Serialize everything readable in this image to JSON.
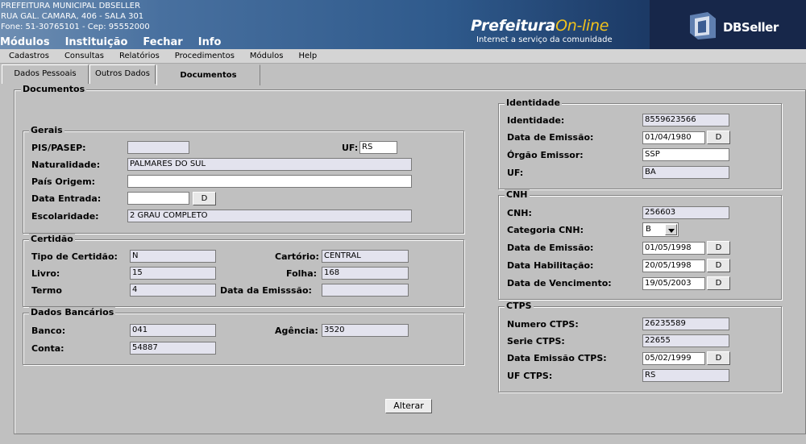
{
  "header": {
    "org_name": "PREFEITURA MUNICIPAL DBSELLER",
    "address": "RUA GAL. CAMARA, 406 - SALA 301",
    "phone_line": "Fone: 51-30765101  -  Cep: 95552000",
    "top_menu": [
      "Módulos",
      "Instituição",
      "Fechar",
      "Info"
    ],
    "logo_text": "Prefeitura",
    "logo_accent": "On-line",
    "logo_tagline": "Internet a serviço da comunidade",
    "brand": "DBSeller"
  },
  "menubar": [
    "Cadastros",
    "Consultas",
    "Relatórios",
    "Procedimentos",
    "Módulos",
    "Help"
  ],
  "tabs": [
    "Dados Pessoais",
    "Outros Dados",
    "Documentos"
  ],
  "active_tab": "Documentos",
  "panel_title": "Documentos",
  "gerais": {
    "title": "Gerais",
    "pis_label": "PIS/PASEP:",
    "pis_value": "",
    "uf_label": "UF:",
    "uf_value": "RS",
    "naturalidade_label": "Naturalidade:",
    "naturalidade_value": "PALMARES DO SUL",
    "pais_label": "País Origem:",
    "pais_value": "",
    "data_entrada_label": "Data Entrada:",
    "data_entrada_value": "",
    "escolaridade_label": "Escolaridade:",
    "escolaridade_value": "2 GRAU COMPLETO"
  },
  "certidao": {
    "title": "Certidão",
    "tipo_label": "Tipo de Certidão:",
    "tipo_value": "N",
    "cartorio_label": "Cartório:",
    "cartorio_value": "CENTRAL",
    "livro_label": "Livro:",
    "livro_value": "15",
    "folha_label": "Folha:",
    "folha_value": "168",
    "termo_label": "Termo",
    "termo_value": "4",
    "data_emissao_label": "Data da Emisssão:",
    "data_emissao_value": ""
  },
  "bancarios": {
    "title": "Dados Bancários",
    "banco_label": "Banco:",
    "banco_value": "041",
    "agencia_label": "Agência:",
    "agencia_value": "3520",
    "conta_label": "Conta:",
    "conta_value": "54887"
  },
  "identidade": {
    "title": "Identidade",
    "identidade_label": "Identidade:",
    "identidade_value": "8559623566",
    "data_emissao_label": "Data de Emissão:",
    "data_emissao_value": "01/04/1980",
    "orgao_label": "Órgão Emissor:",
    "orgao_value": "SSP",
    "uf_label": "UF:",
    "uf_value": "BA"
  },
  "cnh": {
    "title": "CNH",
    "cnh_label": "CNH:",
    "cnh_value": "256603",
    "categoria_label": "Categoria CNH:",
    "categoria_value": "B",
    "data_emissao_label": "Data de Emissão:",
    "data_emissao_value": "01/05/1998",
    "data_habilitacao_label": "Data Habilitação:",
    "data_habilitacao_value": "20/05/1998",
    "data_vencimento_label": "Data de Vencimento:",
    "data_vencimento_value": "19/05/2003"
  },
  "ctps": {
    "title": "CTPS",
    "numero_label": "Numero CTPS:",
    "numero_value": "26235589",
    "serie_label": "Serie CTPS:",
    "serie_value": "22655",
    "data_emissao_label": "Data Emissão CTPS:",
    "data_emissao_value": "05/02/1999",
    "uf_label": "UF CTPS:",
    "uf_value": "RS"
  },
  "date_button_label": "D",
  "alterar_label": "Alterar",
  "colors": {
    "header_blue": "#2f5a8c",
    "logo_accent": "#f2c21b",
    "panel_bg": "#c0c0c0",
    "readonly_field": "#e3e3ee"
  }
}
